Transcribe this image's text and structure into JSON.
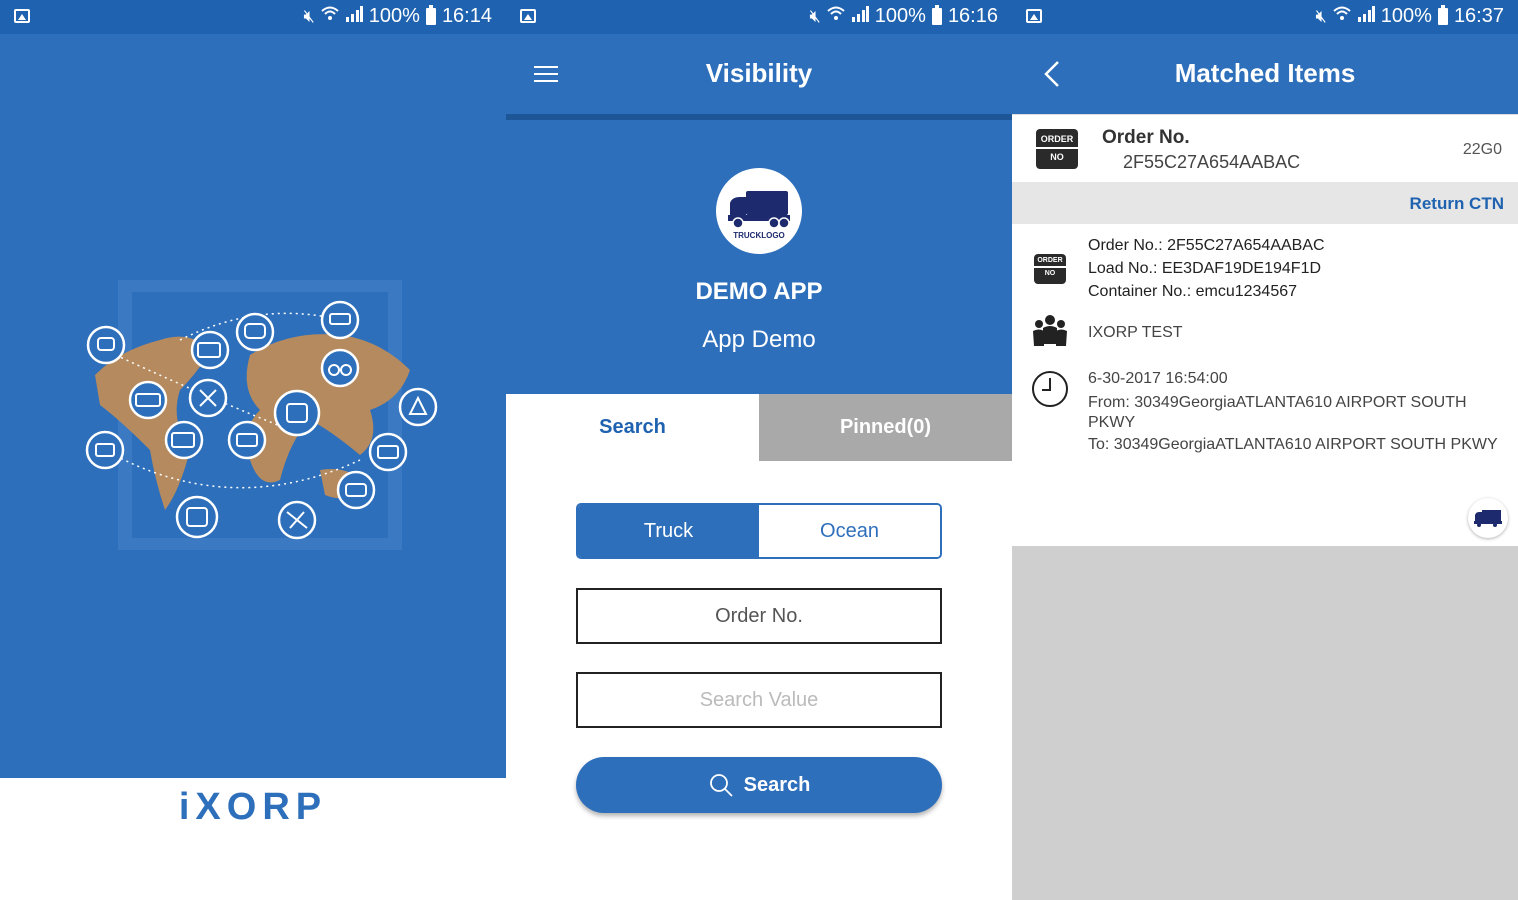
{
  "screens": [
    {
      "status": {
        "battery": "100%",
        "time": "16:14"
      },
      "brand": "iXORP"
    },
    {
      "status": {
        "battery": "100%",
        "time": "16:16"
      },
      "title": "Visibility",
      "company_logo_text": "TRUCKLOGO",
      "app_name": "DEMO APP",
      "app_subtitle": "App Demo",
      "tabs": [
        {
          "label": "Search"
        },
        {
          "label": "Pinned(0)"
        }
      ],
      "segments": [
        {
          "label": "Truck"
        },
        {
          "label": "Ocean"
        }
      ],
      "field_type_value": "Order No.",
      "search_placeholder": "Search Value",
      "search_button": "Search"
    },
    {
      "status": {
        "battery": "100%",
        "time": "16:37"
      },
      "title": "Matched Items",
      "badge": {
        "top": "ORDER",
        "bottom": "NO"
      },
      "card": {
        "label": "Order No.",
        "value": "2F55C27A654AABAC",
        "code": "22G0"
      },
      "return_link": "Return CTN",
      "detail": {
        "order": "Order No.: 2F55C27A654AABAC",
        "load": "Load No.: EE3DAF19DE194F1D",
        "container": "Container No.: emcu1234567",
        "company": "IXORP TEST",
        "datetime": "6-30-2017 16:54:00",
        "from": "From: 30349GeorgiaATLANTA610 AIRPORT SOUTH PKWY",
        "to": "To: 30349GeorgiaATLANTA610 AIRPORT SOUTH PKWY"
      }
    }
  ],
  "colors": {
    "primary": "#2d6fbb",
    "status_bar": "#1f63b0",
    "map_land": "#b58a5e",
    "inactive_tab": "#a9a9a9"
  }
}
